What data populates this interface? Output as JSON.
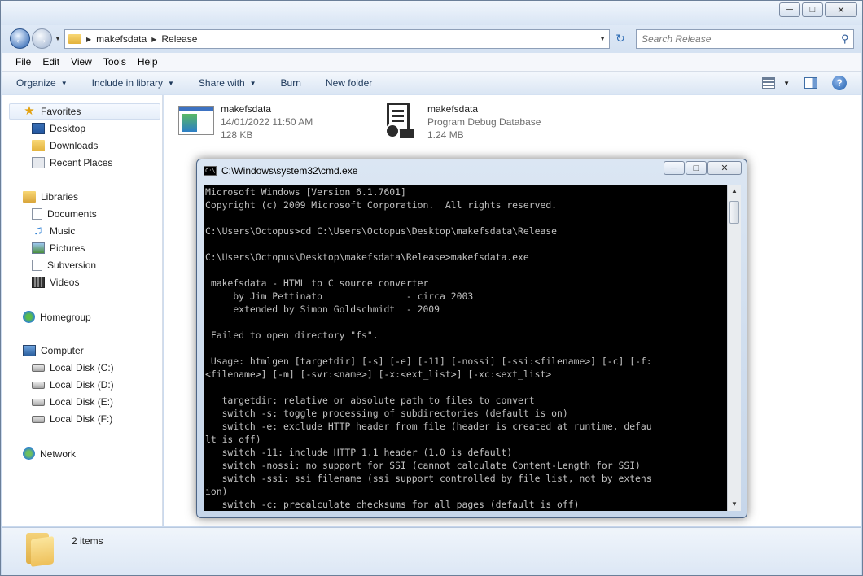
{
  "address": {
    "crumbs": [
      "makefsdata",
      "Release"
    ],
    "search_placeholder": "Search Release"
  },
  "menu": [
    "File",
    "Edit",
    "View",
    "Tools",
    "Help"
  ],
  "commands": {
    "organize": "Organize",
    "include": "Include in library",
    "share": "Share with",
    "burn": "Burn",
    "new_folder": "New folder"
  },
  "nav": {
    "favorites": "Favorites",
    "desktop": "Desktop",
    "downloads": "Downloads",
    "recent": "Recent Places",
    "libraries": "Libraries",
    "documents": "Documents",
    "music": "Music",
    "pictures": "Pictures",
    "subversion": "Subversion",
    "videos": "Videos",
    "homegroup": "Homegroup",
    "computer": "Computer",
    "disk_c": "Local Disk (C:)",
    "disk_d": "Local Disk (D:)",
    "disk_e": "Local Disk (E:)",
    "disk_f": "Local Disk (F:)",
    "network": "Network"
  },
  "files": [
    {
      "name": "makefsdata",
      "line2": "14/01/2022 11:50 AM",
      "line3": "128 KB"
    },
    {
      "name": "makefsdata",
      "line2": "Program Debug Database",
      "line3": "1.24 MB"
    }
  ],
  "status": {
    "count": "2 items"
  },
  "cmd": {
    "title": "C:\\Windows\\system32\\cmd.exe",
    "output": "Microsoft Windows [Version 6.1.7601]\nCopyright (c) 2009 Microsoft Corporation.  All rights reserved.\n\nC:\\Users\\Octopus>cd C:\\Users\\Octopus\\Desktop\\makefsdata\\Release\n\nC:\\Users\\Octopus\\Desktop\\makefsdata\\Release>makefsdata.exe\n\n makefsdata - HTML to C source converter\n     by Jim Pettinato               - circa 2003\n     extended by Simon Goldschmidt  - 2009\n\n Failed to open directory \"fs\".\n\n Usage: htmlgen [targetdir] [-s] [-e] [-11] [-nossi] [-ssi:<filename>] [-c] [-f:\n<filename>] [-m] [-svr:<name>] [-x:<ext_list>] [-xc:<ext_list>\n\n   targetdir: relative or absolute path to files to convert\n   switch -s: toggle processing of subdirectories (default is on)\n   switch -e: exclude HTTP header from file (header is created at runtime, defau\nlt is off)\n   switch -11: include HTTP 1.1 header (1.0 is default)\n   switch -nossi: no support for SSI (cannot calculate Content-Length for SSI)\n   switch -ssi: ssi filename (ssi support controlled by file list, not by extens\nion)\n   switch -c: precalculate checksums for all pages (default is off)"
  }
}
